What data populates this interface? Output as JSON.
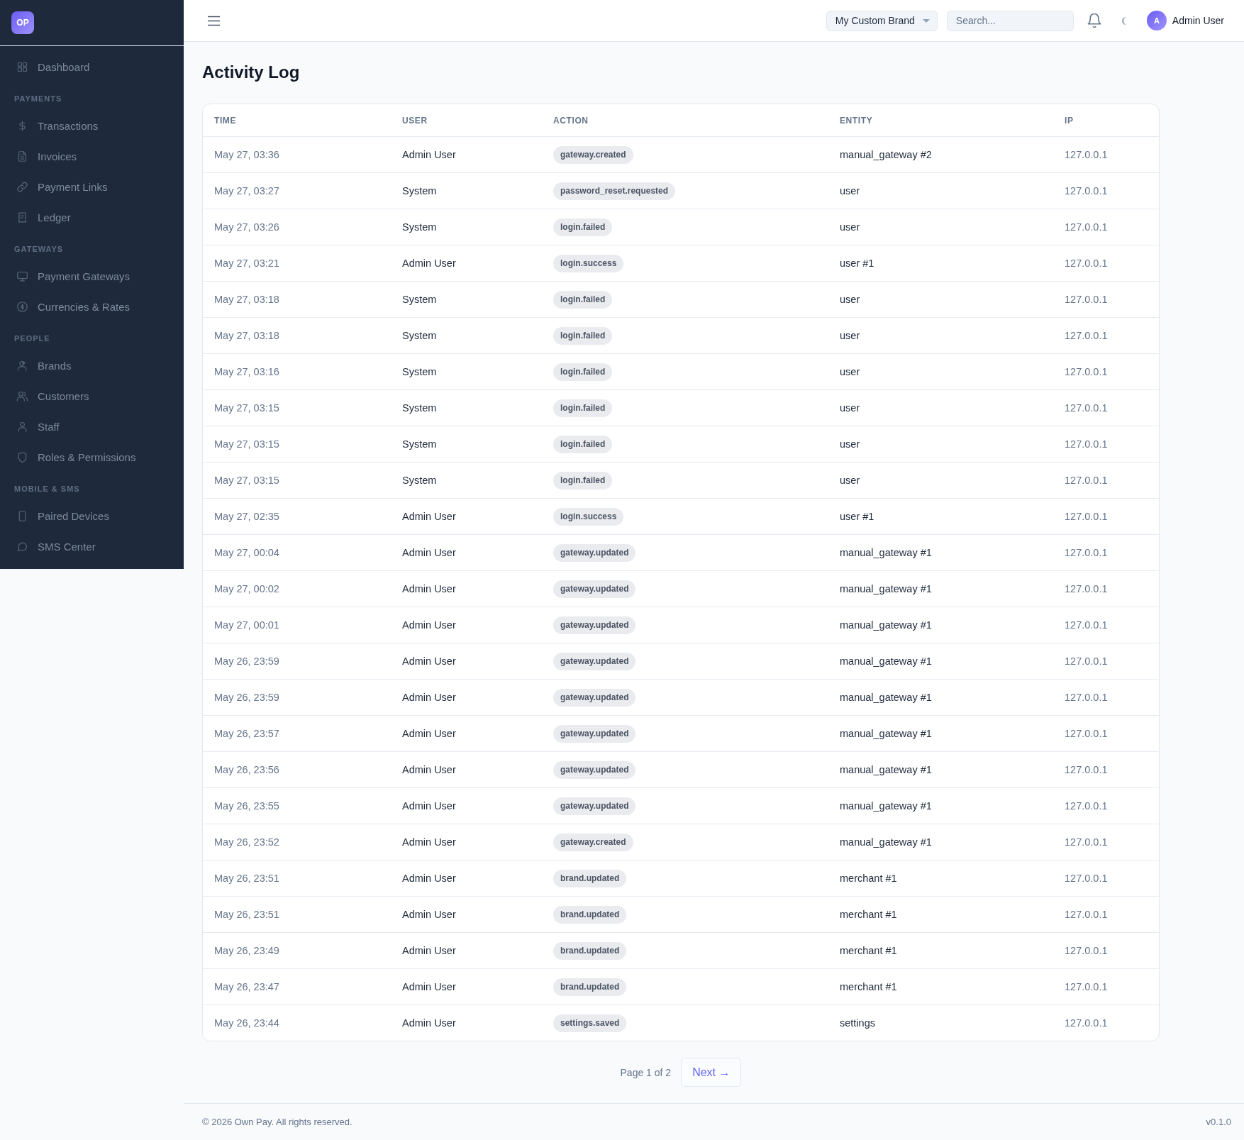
{
  "sidebar": {
    "logo": "OP",
    "items": [
      {
        "label": "Dashboard",
        "selected": false
      }
    ],
    "sections": [
      {
        "heading": "PAYMENTS",
        "items": [
          {
            "label": "Transactions",
            "selected": false
          },
          {
            "label": "Invoices",
            "selected": false
          },
          {
            "label": "Payment Links",
            "selected": false
          },
          {
            "label": "Ledger",
            "selected": false
          }
        ]
      },
      {
        "heading": "GATEWAYS",
        "items": [
          {
            "label": "Payment Gateways",
            "selected": false
          },
          {
            "label": "Currencies & Rates",
            "selected": false
          }
        ]
      },
      {
        "heading": "PEOPLE",
        "items": [
          {
            "label": "Brands",
            "selected": false
          },
          {
            "label": "Customers",
            "selected": false
          },
          {
            "label": "Staff",
            "selected": false
          },
          {
            "label": "Roles & Permissions",
            "selected": false
          }
        ]
      },
      {
        "heading": "MOBILE & SMS",
        "items": [
          {
            "label": "Paired Devices",
            "selected": false
          },
          {
            "label": "SMS Center",
            "selected": false
          }
        ]
      }
    ]
  },
  "topbar": {
    "brand_select": {
      "value": "My Custom Brand"
    },
    "search": {
      "placeholder": "Search..."
    },
    "user": {
      "avatar": "A",
      "name": "Admin User"
    }
  },
  "page_title": "Activity Log",
  "table": {
    "columns": [
      "TIME",
      "USER",
      "ACTION",
      "ENTITY",
      "IP"
    ],
    "rows": [
      {
        "time": "May 27, 03:36",
        "user": "Admin User",
        "action": "gateway.created",
        "entity": "manual_gateway #2",
        "ip": "127.0.0.1"
      },
      {
        "time": "May 27, 03:27",
        "user": "System",
        "action": "password_reset.requested",
        "entity": "user",
        "ip": "127.0.0.1"
      },
      {
        "time": "May 27, 03:26",
        "user": "System",
        "action": "login.failed",
        "entity": "user",
        "ip": "127.0.0.1"
      },
      {
        "time": "May 27, 03:21",
        "user": "Admin User",
        "action": "login.success",
        "entity": "user #1",
        "ip": "127.0.0.1"
      },
      {
        "time": "May 27, 03:18",
        "user": "System",
        "action": "login.failed",
        "entity": "user",
        "ip": "127.0.0.1"
      },
      {
        "time": "May 27, 03:18",
        "user": "System",
        "action": "login.failed",
        "entity": "user",
        "ip": "127.0.0.1"
      },
      {
        "time": "May 27, 03:16",
        "user": "System",
        "action": "login.failed",
        "entity": "user",
        "ip": "127.0.0.1"
      },
      {
        "time": "May 27, 03:15",
        "user": "System",
        "action": "login.failed",
        "entity": "user",
        "ip": "127.0.0.1"
      },
      {
        "time": "May 27, 03:15",
        "user": "System",
        "action": "login.failed",
        "entity": "user",
        "ip": "127.0.0.1"
      },
      {
        "time": "May 27, 03:15",
        "user": "System",
        "action": "login.failed",
        "entity": "user",
        "ip": "127.0.0.1"
      },
      {
        "time": "May 27, 02:35",
        "user": "Admin User",
        "action": "login.success",
        "entity": "user #1",
        "ip": "127.0.0.1"
      },
      {
        "time": "May 27, 00:04",
        "user": "Admin User",
        "action": "gateway.updated",
        "entity": "manual_gateway #1",
        "ip": "127.0.0.1"
      },
      {
        "time": "May 27, 00:02",
        "user": "Admin User",
        "action": "gateway.updated",
        "entity": "manual_gateway #1",
        "ip": "127.0.0.1"
      },
      {
        "time": "May 27, 00:01",
        "user": "Admin User",
        "action": "gateway.updated",
        "entity": "manual_gateway #1",
        "ip": "127.0.0.1"
      },
      {
        "time": "May 26, 23:59",
        "user": "Admin User",
        "action": "gateway.updated",
        "entity": "manual_gateway #1",
        "ip": "127.0.0.1"
      },
      {
        "time": "May 26, 23:59",
        "user": "Admin User",
        "action": "gateway.updated",
        "entity": "manual_gateway #1",
        "ip": "127.0.0.1"
      },
      {
        "time": "May 26, 23:57",
        "user": "Admin User",
        "action": "gateway.updated",
        "entity": "manual_gateway #1",
        "ip": "127.0.0.1"
      },
      {
        "time": "May 26, 23:56",
        "user": "Admin User",
        "action": "gateway.updated",
        "entity": "manual_gateway #1",
        "ip": "127.0.0.1"
      },
      {
        "time": "May 26, 23:55",
        "user": "Admin User",
        "action": "gateway.updated",
        "entity": "manual_gateway #1",
        "ip": "127.0.0.1"
      },
      {
        "time": "May 26, 23:52",
        "user": "Admin User",
        "action": "gateway.created",
        "entity": "manual_gateway #1",
        "ip": "127.0.0.1"
      },
      {
        "time": "May 26, 23:51",
        "user": "Admin User",
        "action": "brand.updated",
        "entity": "merchant #1",
        "ip": "127.0.0.1"
      },
      {
        "time": "May 26, 23:51",
        "user": "Admin User",
        "action": "brand.updated",
        "entity": "merchant #1",
        "ip": "127.0.0.1"
      },
      {
        "time": "May 26, 23:49",
        "user": "Admin User",
        "action": "brand.updated",
        "entity": "merchant #1",
        "ip": "127.0.0.1"
      },
      {
        "time": "May 26, 23:47",
        "user": "Admin User",
        "action": "brand.updated",
        "entity": "merchant #1",
        "ip": "127.0.0.1"
      },
      {
        "time": "May 26, 23:44",
        "user": "Admin User",
        "action": "settings.saved",
        "entity": "settings",
        "ip": "127.0.0.1"
      }
    ]
  },
  "pagination": {
    "label": "Page 1 of 2",
    "next": "Next →"
  },
  "footer": {
    "copyright": "© 2026 Own Pay. All rights reserved.",
    "version": "v0.1.0"
  }
}
